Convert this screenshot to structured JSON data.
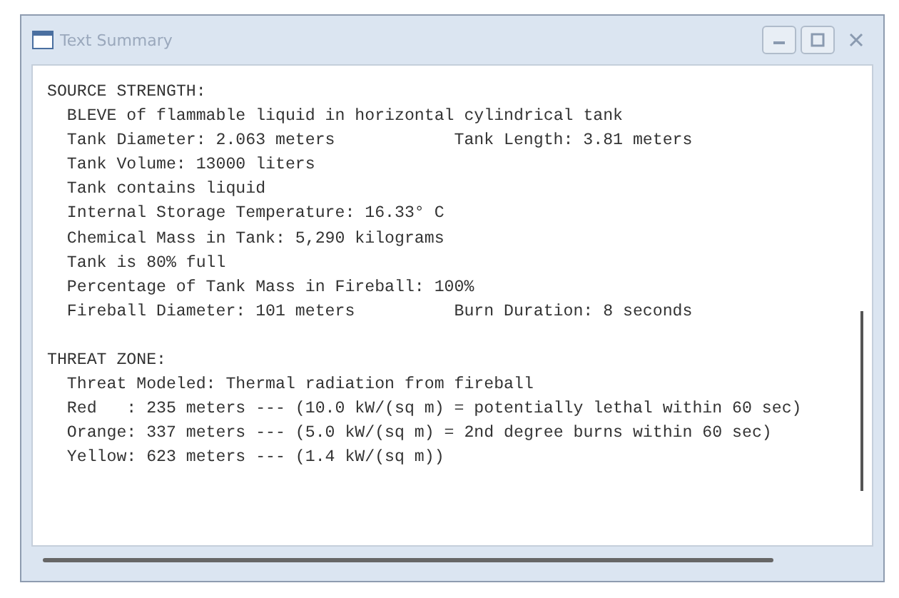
{
  "window": {
    "title": "Text Summary"
  },
  "sections": [
    {
      "heading": "SOURCE STRENGTH:",
      "lines": [
        [
          "BLEVE of flammable liquid in horizontal cylindrical tank"
        ],
        [
          "Tank Diameter: 2.063 meters",
          "Tank Length: 3.81 meters"
        ],
        [
          "Tank Volume: 13000 liters"
        ],
        [
          "Tank contains liquid"
        ],
        [
          "Internal Storage Temperature: 16.33° C"
        ],
        [
          "Chemical Mass in Tank: 5,290 kilograms"
        ],
        [
          "Tank is 80% full"
        ],
        [
          "Percentage of Tank Mass in Fireball: 100%"
        ],
        [
          "Fireball Diameter: 101 meters",
          "Burn Duration: 8 seconds"
        ]
      ]
    },
    {
      "heading": "THREAT ZONE:",
      "lines": [
        [
          "Threat Modeled: Thermal radiation from fireball"
        ],
        [
          "Red   : 235 meters --- (10.0 kW/(sq m) = potentially lethal within 60 sec)"
        ],
        [
          "Orange: 337 meters --- (5.0 kW/(sq m) = 2nd degree burns within 60 sec)"
        ],
        [
          "Yellow: 623 meters --- (1.4 kW/(sq m))"
        ]
      ]
    }
  ]
}
